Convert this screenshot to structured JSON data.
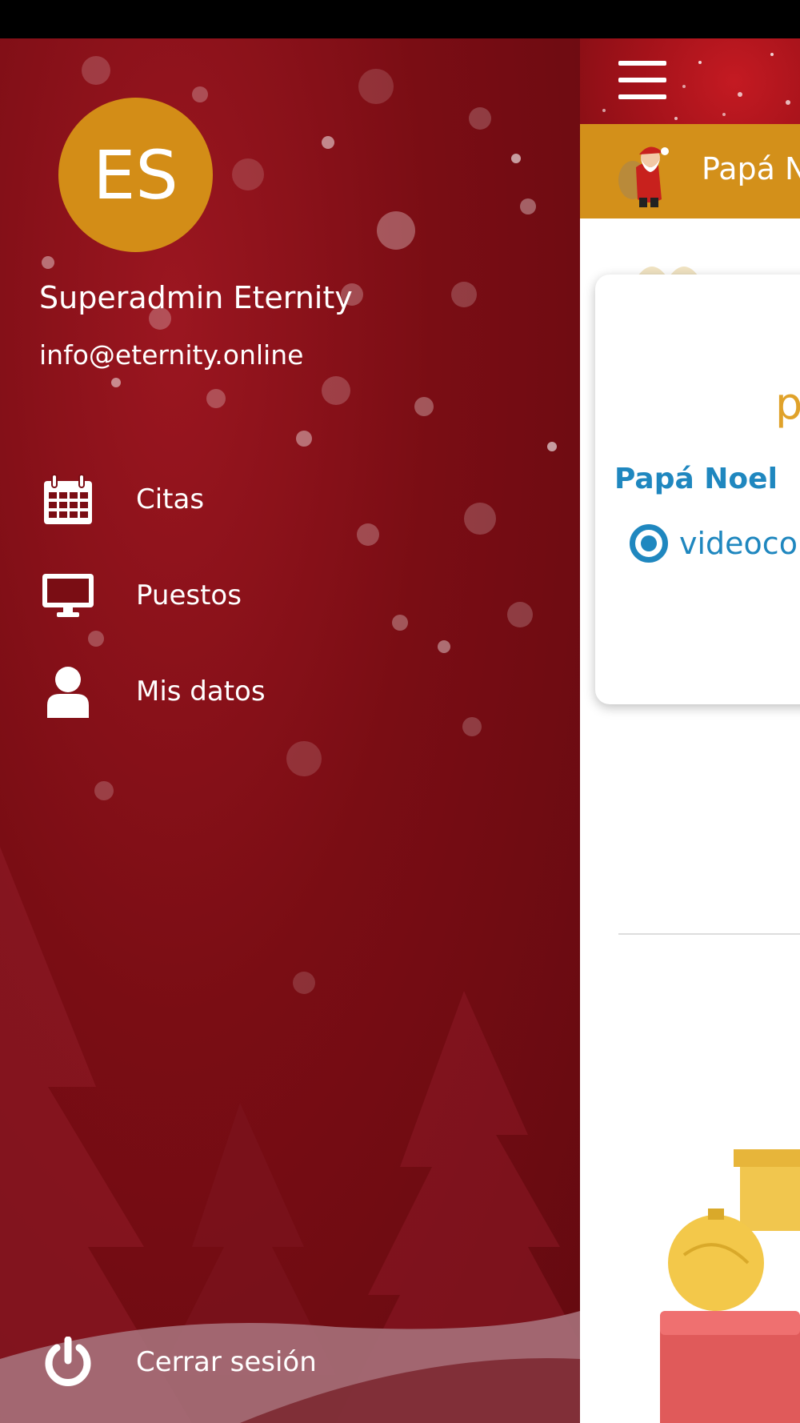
{
  "user": {
    "initials": "ES",
    "name": "Superadmin Eternity",
    "email": "info@eternity.online"
  },
  "menu": [
    {
      "label": "Citas",
      "icon": "calendar-icon"
    },
    {
      "label": "Puestos",
      "icon": "monitor-icon"
    },
    {
      "label": "Mis datos",
      "icon": "user-icon"
    }
  ],
  "logout": {
    "label": "Cerrar sesión",
    "icon": "power-icon"
  },
  "main": {
    "header_title": "Papá N",
    "card": {
      "letter": "p",
      "name": "Papá Noel",
      "option_label": "videocon"
    }
  },
  "colors": {
    "drawer_bg": "#7a0d14",
    "accent_gold": "#d3901a",
    "link_blue": "#1f87bf"
  }
}
